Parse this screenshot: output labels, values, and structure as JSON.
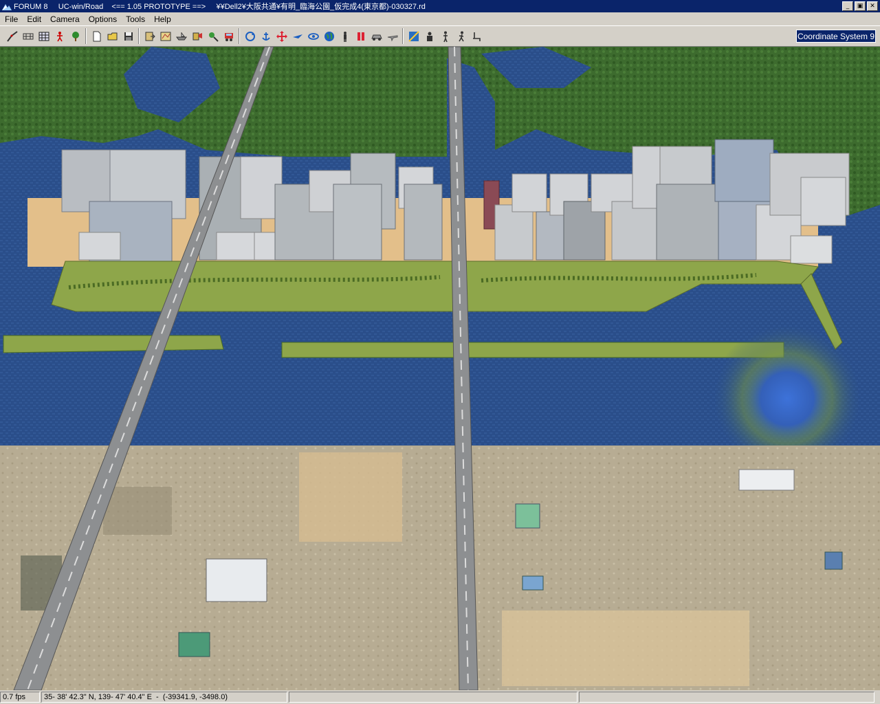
{
  "window": {
    "title": "FORUM 8     UC-win/Road    <== 1.05 PROTOTYPE ==>     ¥¥Dell2¥大阪共通¥有明_臨海公園_仮完成4(東京都)-030327.rd",
    "minimize_glyph": "_",
    "maximize_glyph": "▣",
    "close_glyph": "✕"
  },
  "menu": {
    "items": [
      {
        "label": "File"
      },
      {
        "label": "Edit"
      },
      {
        "label": "Camera"
      },
      {
        "label": "Options"
      },
      {
        "label": "Tools"
      },
      {
        "label": "Help"
      }
    ]
  },
  "toolbar": {
    "icons": [
      "road-edit-icon",
      "cross-section-icon",
      "grid-terrain-icon",
      "person-red-icon",
      "tree-icon",
      "new-file-icon",
      "open-folder-icon",
      "save-disk-icon",
      "export-icon",
      "map-icon",
      "boat-icon",
      "paint-icon",
      "landscape-icon",
      "vehicle-icon",
      "rotate-camera-icon",
      "anchor-icon",
      "move-cross-icon",
      "fly-icon",
      "orbit-icon",
      "globe-icon",
      "walker-icon",
      "pause-icon",
      "car-icon",
      "airplane-icon",
      "slope-icon",
      "driver-icon",
      "stand-person-icon",
      "walk-person-icon",
      "seat-icon"
    ],
    "coordinate_system_label": "Coordinate System 9"
  },
  "status": {
    "fps": "0.7 fps",
    "position": "35- 38' 42.3\" N, 139- 47' 40.4\" E  -  (-39341.9, -3498.0)",
    "extra1": "",
    "extra2": ""
  },
  "colors": {
    "titlebar": "#0a246a",
    "water": "#2a4e8a",
    "forest": "#3d6b2e",
    "park": "#8ea64a",
    "sand": "#e3bf8a",
    "ground": "#b7ac93"
  }
}
